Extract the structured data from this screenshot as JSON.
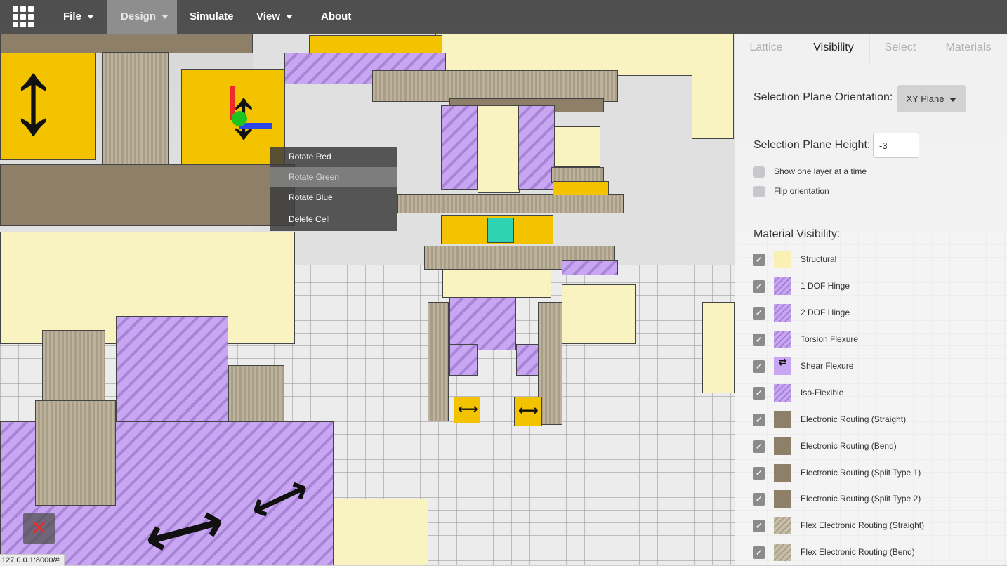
{
  "menubar": {
    "items": [
      {
        "label": "File",
        "has_caret": true
      },
      {
        "label": "Design",
        "has_caret": true,
        "active": true
      },
      {
        "label": "Simulate",
        "has_caret": false
      },
      {
        "label": "View",
        "has_caret": true
      },
      {
        "label": "About",
        "has_caret": false
      }
    ],
    "logo_icon": "grid-app-icon"
  },
  "context_menu": {
    "items": [
      {
        "label": "Rotate Red"
      },
      {
        "label": "Rotate Green",
        "hovered": true
      },
      {
        "label": "Rotate Blue"
      },
      {
        "label": "Delete Cell"
      }
    ]
  },
  "panel": {
    "tabs": [
      {
        "label": "Lattice"
      },
      {
        "label": "Visibility",
        "active": true
      },
      {
        "label": "Select"
      },
      {
        "label": "Materials"
      }
    ],
    "plane_orientation_label": "Selection Plane Orientation:",
    "plane_orientation_value": "XY Plane",
    "plane_height_label": "Selection Plane Height:",
    "plane_height_value": "-3",
    "show_one_layer_label": "Show one layer at a time",
    "flip_orientation_label": "Flip orientation",
    "material_visibility_label": "Material Visibility:",
    "materials": [
      {
        "label": "Structural",
        "checked": true,
        "swatch": "#fbf0b4",
        "pattern": "solid"
      },
      {
        "label": "1 DOF Hinge",
        "checked": true,
        "swatch": "#c9a6f2",
        "pattern": "hinge"
      },
      {
        "label": "2 DOF Hinge",
        "checked": true,
        "swatch": "#c9a6f2",
        "pattern": "hinge"
      },
      {
        "label": "Torsion Flexure",
        "checked": true,
        "swatch": "#c9a6f2",
        "pattern": "hinge"
      },
      {
        "label": "Shear Flexure",
        "checked": true,
        "swatch": "#c9a6f2",
        "pattern": "shear"
      },
      {
        "label": "Iso-Flexible",
        "checked": true,
        "swatch": "#c9a6f2",
        "pattern": "hinge"
      },
      {
        "label": "Electronic Routing (Straight)",
        "checked": true,
        "swatch": "#8e8068",
        "pattern": "solid"
      },
      {
        "label": "Electronic Routing (Bend)",
        "checked": true,
        "swatch": "#8e8068",
        "pattern": "solid"
      },
      {
        "label": "Electronic Routing (Split Type 1)",
        "checked": true,
        "swatch": "#8e8068",
        "pattern": "solid"
      },
      {
        "label": "Electronic Routing (Split Type 2)",
        "checked": true,
        "swatch": "#8e8068",
        "pattern": "solid"
      },
      {
        "label": "Flex Electronic Routing (Straight)",
        "checked": true,
        "swatch": "#b8ae98",
        "pattern": "flex"
      },
      {
        "label": "Flex Electronic Routing (Bend)",
        "checked": true,
        "swatch": "#b8ae98",
        "pattern": "flex"
      }
    ]
  },
  "close_icon": "close-icon",
  "status_url": "127.0.0.1:8000/#",
  "colors": {
    "menubar": "#3c3c3c",
    "structural": "#f8f3c0",
    "hinge": "#c9a6f2",
    "routing": "#8e8068",
    "actuator": "#f4c300"
  }
}
